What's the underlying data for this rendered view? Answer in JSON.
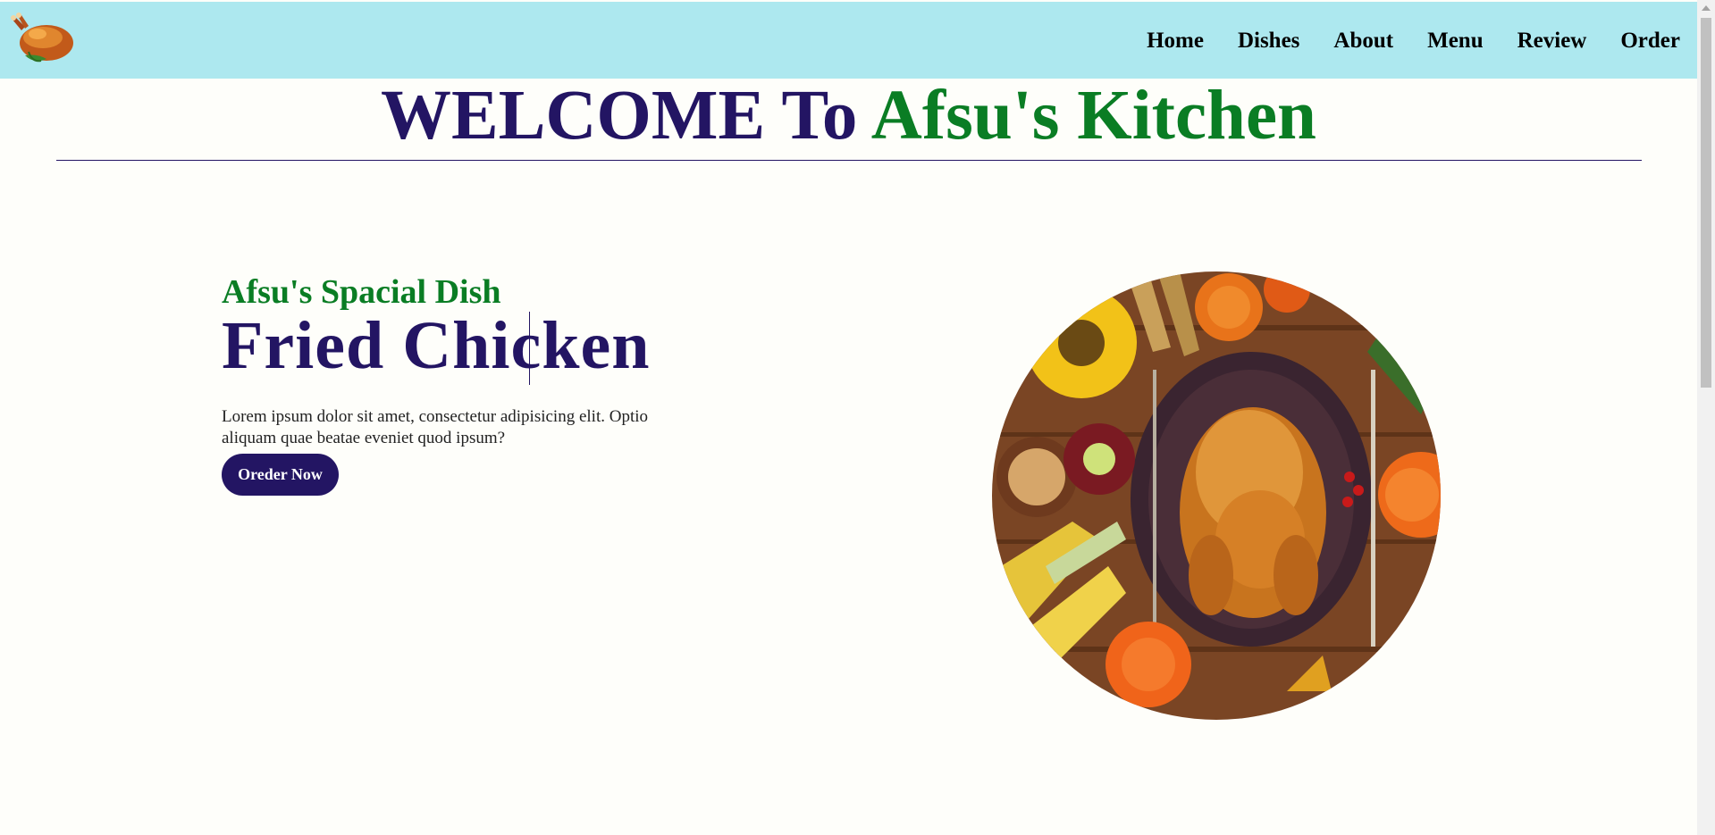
{
  "header": {
    "logo_icon": "roast-chicken-logo",
    "nav": [
      "Home",
      "Dishes",
      "About",
      "Menu",
      "Review",
      "Order"
    ]
  },
  "welcome": {
    "prefix": "WELCOME To ",
    "brand": "Afsu's Kitchen"
  },
  "hero": {
    "subtitle": "Afsu's Spacial Dish",
    "title": "Fried Chicken",
    "description": "Lorem ipsum dolor sit amet, consectetur adipisicing elit. Optio aliquam quae beatae eveniet quod ipsum?",
    "button_label": "Oreder Now",
    "image_icon": "roast-chicken-platter-image"
  },
  "colors": {
    "navbar": "#ade8ef",
    "navy": "#231563",
    "green": "#0a7d24",
    "background": "#fefefa"
  }
}
